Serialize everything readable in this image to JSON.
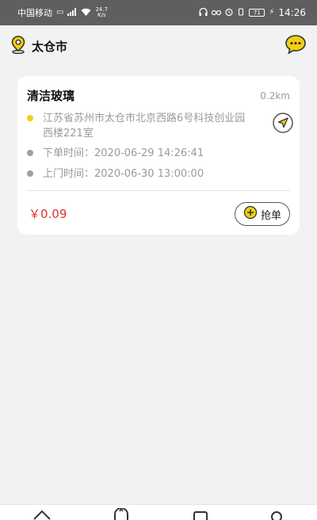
{
  "status_bar": {
    "carrier": "中国移动",
    "net_speed_value": "24.7",
    "net_speed_unit": "K/s",
    "battery": "71",
    "time": "14:26"
  },
  "header": {
    "city": "太仓市",
    "location_icon": "location-pin-icon",
    "message_icon": "chat-bubble-icon"
  },
  "order": {
    "service": "清洁玻璃",
    "distance": "0.2km",
    "address": "江苏省苏州市太仓市北京西路6号科技创业园西楼221室",
    "order_time_label": "下单时间：",
    "order_time": "2020-06-29 14:26:41",
    "visit_time_label": "上门时间：",
    "visit_time": "2020-06-30 13:00:00",
    "price": "￥0.09",
    "grab_label": "抢单"
  },
  "colors": {
    "accent": "#f2cf12",
    "price": "#e0302a",
    "muted": "#9a9a9a"
  },
  "bottom_nav": {
    "icons": [
      "home-icon",
      "orders-icon",
      "list-icon",
      "profile-icon"
    ]
  }
}
